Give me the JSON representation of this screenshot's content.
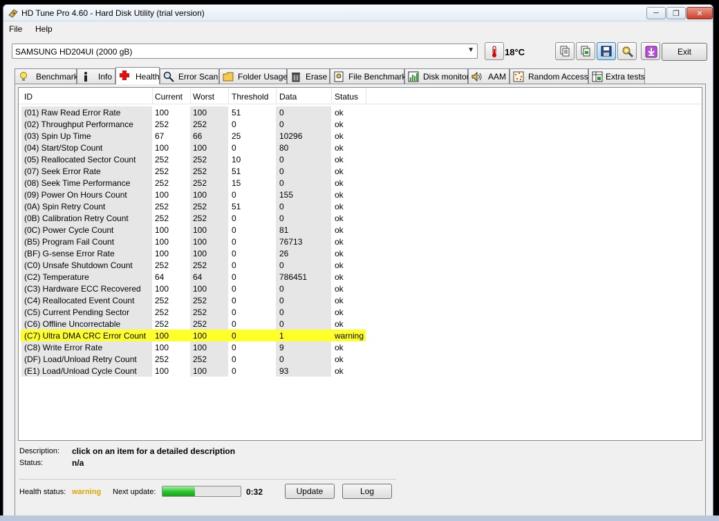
{
  "window": {
    "title": "HD Tune Pro 4.60 - Hard Disk Utility (trial version)"
  },
  "menu": {
    "items": [
      "File",
      "Help"
    ]
  },
  "toolbar": {
    "drive": "SAMSUNG HD204UI (2000 gB)",
    "temperature": "18°C",
    "exit_label": "Exit"
  },
  "tabs": [
    {
      "label": "Benchmark",
      "icon": "lightbulb-icon"
    },
    {
      "label": "Info",
      "icon": "info-icon"
    },
    {
      "label": "Health",
      "icon": "red-cross-icon",
      "active": true
    },
    {
      "label": "Error Scan",
      "icon": "magnifier-icon"
    },
    {
      "label": "Folder Usage",
      "icon": "folder-icon"
    },
    {
      "label": "Erase",
      "icon": "trash-icon"
    },
    {
      "label": "File Benchmark",
      "icon": "file-benchmark-icon"
    },
    {
      "label": "Disk monitor",
      "icon": "chart-icon"
    },
    {
      "label": "AAM",
      "icon": "speaker-icon"
    },
    {
      "label": "Random Access",
      "icon": "random-access-icon"
    },
    {
      "label": "Extra tests",
      "icon": "extra-tests-icon"
    }
  ],
  "table": {
    "headers": [
      "ID",
      "Current",
      "Worst",
      "Threshold",
      "Data",
      "Status"
    ],
    "rows": [
      [
        "(01) Raw Read Error Rate",
        "100",
        "100",
        "51",
        "0",
        "ok"
      ],
      [
        "(02) Throughput Performance",
        "252",
        "252",
        "0",
        "0",
        "ok"
      ],
      [
        "(03) Spin Up Time",
        "67",
        "66",
        "25",
        "10296",
        "ok"
      ],
      [
        "(04) Start/Stop Count",
        "100",
        "100",
        "0",
        "80",
        "ok"
      ],
      [
        "(05) Reallocated Sector Count",
        "252",
        "252",
        "10",
        "0",
        "ok"
      ],
      [
        "(07) Seek Error Rate",
        "252",
        "252",
        "51",
        "0",
        "ok"
      ],
      [
        "(08) Seek Time Performance",
        "252",
        "252",
        "15",
        "0",
        "ok"
      ],
      [
        "(09) Power On Hours Count",
        "100",
        "100",
        "0",
        "155",
        "ok"
      ],
      [
        "(0A) Spin Retry Count",
        "252",
        "252",
        "51",
        "0",
        "ok"
      ],
      [
        "(0B) Calibration Retry Count",
        "252",
        "252",
        "0",
        "0",
        "ok"
      ],
      [
        "(0C) Power Cycle Count",
        "100",
        "100",
        "0",
        "81",
        "ok"
      ],
      [
        "(B5) Program Fail Count",
        "100",
        "100",
        "0",
        "76713",
        "ok"
      ],
      [
        "(BF) G-sense Error Rate",
        "100",
        "100",
        "0",
        "26",
        "ok"
      ],
      [
        "(C0) Unsafe Shutdown Count",
        "252",
        "252",
        "0",
        "0",
        "ok"
      ],
      [
        "(C2) Temperature",
        "64",
        "64",
        "0",
        "786451",
        "ok"
      ],
      [
        "(C3) Hardware ECC Recovered",
        "100",
        "100",
        "0",
        "0",
        "ok"
      ],
      [
        "(C4) Reallocated Event Count",
        "252",
        "252",
        "0",
        "0",
        "ok"
      ],
      [
        "(C5) Current Pending Sector",
        "252",
        "252",
        "0",
        "0",
        "ok"
      ],
      [
        "(C6) Offline Uncorrectable",
        "252",
        "252",
        "0",
        "0",
        "ok"
      ],
      [
        "(C7) Ultra DMA CRC Error Count",
        "100",
        "100",
        "0",
        "1",
        "warning"
      ],
      [
        "(C8) Write Error Rate",
        "100",
        "100",
        "0",
        "9",
        "ok"
      ],
      [
        "(DF) Load/Unload Retry Count",
        "252",
        "252",
        "0",
        "0",
        "ok"
      ],
      [
        "(E1) Load/Unload Cycle Count",
        "100",
        "100",
        "0",
        "93",
        "ok"
      ]
    ]
  },
  "details": {
    "description_label": "Description:",
    "description_value": "click on an item for a detailed description",
    "status_label": "Status:",
    "status_value": "n/a"
  },
  "footer": {
    "health_label": "Health status:",
    "health_value": "warning",
    "next_update_label": "Next update:",
    "progress": 0.42,
    "timer": "0:32",
    "update_label": "Update",
    "log_label": "Log"
  },
  "colors": {
    "warning_highlight": "#ffff2a",
    "warning_text": "#e0a500",
    "progress_fill": "#29c42a"
  }
}
